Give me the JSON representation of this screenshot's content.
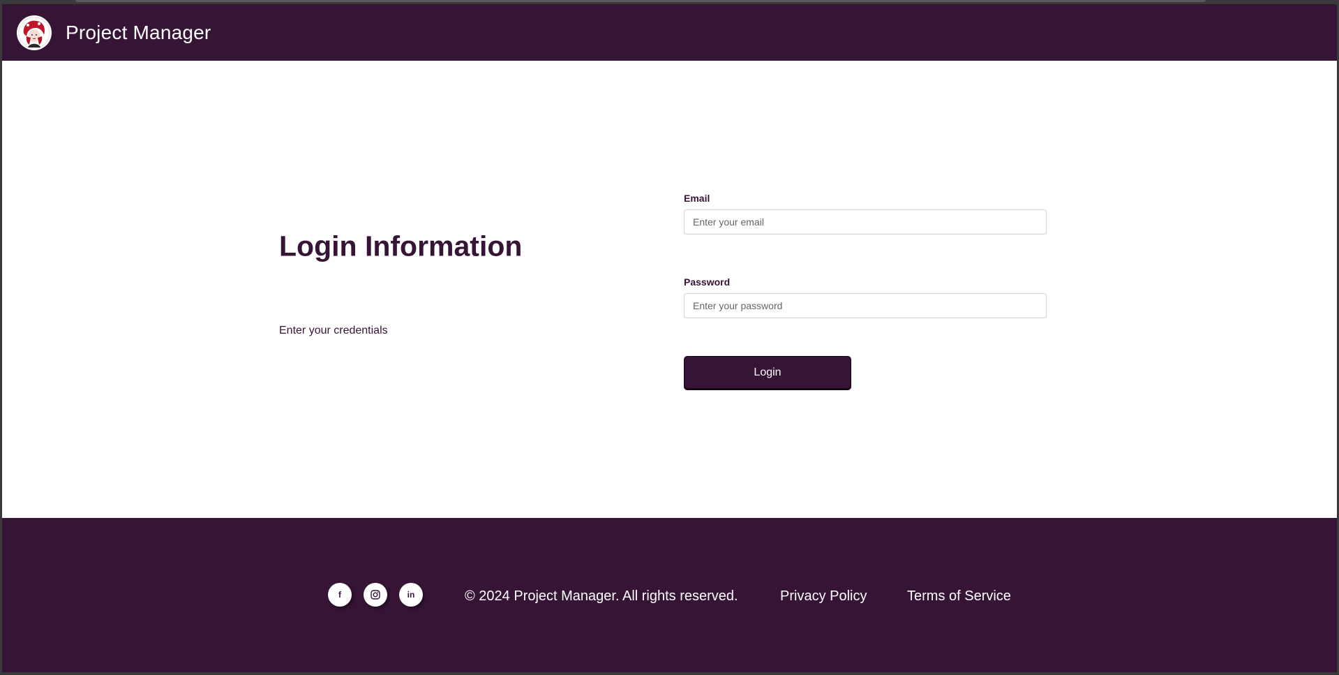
{
  "header": {
    "title": "Project Manager",
    "logo_icon": "avatar-logo-icon"
  },
  "login": {
    "heading": "Login Information",
    "subtitle": "Enter your credentials",
    "email_label": "Email",
    "email_placeholder": "Enter your email",
    "email_value": "",
    "password_label": "Password",
    "password_placeholder": "Enter your password",
    "password_value": "",
    "submit_label": "Login"
  },
  "footer": {
    "social": [
      {
        "icon": "facebook-icon",
        "glyph": "f"
      },
      {
        "icon": "instagram-icon",
        "glyph": ""
      },
      {
        "icon": "linkedin-icon",
        "glyph": "in"
      }
    ],
    "copyright": "© 2024 Project Manager. All rights reserved.",
    "privacy_label": "Privacy Policy",
    "terms_label": "Terms of Service"
  },
  "colors": {
    "brand": "#361436",
    "background": "#ffffff",
    "text_light": "#ffffff"
  }
}
